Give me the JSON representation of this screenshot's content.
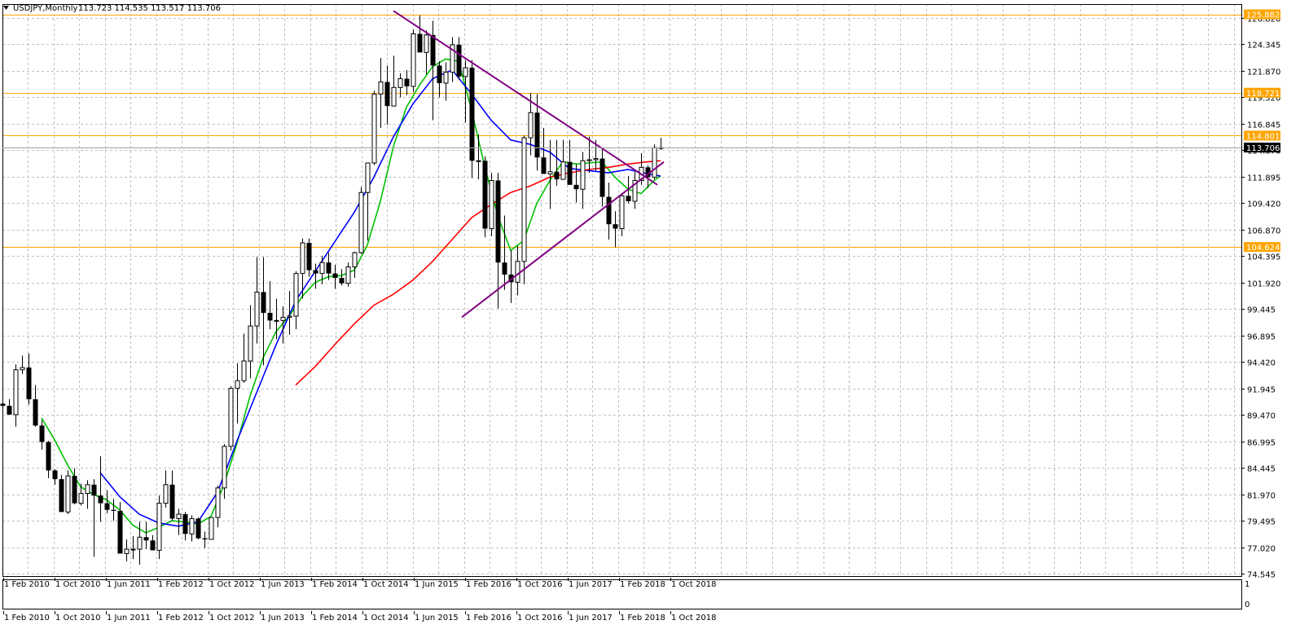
{
  "header": {
    "symbol_label": "USDJPY,Monthly",
    "ohlc": "113.723 114.535 113.517 113.706"
  },
  "colors": {
    "background": "#ffffff",
    "grid": "#c0c0c0",
    "candle": "#000000",
    "level": "#ffa500",
    "trendline": "#800080",
    "ma_fast": "#00c000",
    "ma_mid": "#0000ff",
    "ma_slow": "#ff0000",
    "price_tag": "#000000"
  },
  "chart_data": {
    "type": "candlestick",
    "symbol": "USDJPY",
    "timeframe": "Monthly",
    "x_ticks": [
      "1 Feb 2010",
      "1 Oct 2010",
      "1 Jun 2011",
      "1 Feb 2012",
      "1 Oct 2012",
      "1 Jun 2013",
      "1 Feb 2014",
      "1 Oct 2014",
      "1 Jun 2015",
      "1 Feb 2016",
      "1 Oct 2016",
      "1 Jun 2017",
      "1 Feb 2018",
      "1 Oct 2018"
    ],
    "y_ticks": [
      "126.820",
      "124.345",
      "121.870",
      "119.320",
      "116.845",
      "114.370",
      "111.895",
      "109.420",
      "106.870",
      "104.395",
      "101.920",
      "99.445",
      "96.895",
      "94.420",
      "91.945",
      "89.470",
      "86.995",
      "84.445",
      "81.970",
      "79.495",
      "77.020",
      "74.545"
    ],
    "ylim": [
      74.545,
      126.82
    ],
    "levels": [
      {
        "price": 125.882,
        "label": "125.882"
      },
      {
        "price": 118.721,
        "label": "118.721"
      },
      {
        "price": 114.801,
        "label": "114.801"
      },
      {
        "price": 104.624,
        "label": "104.624"
      }
    ],
    "current_price": {
      "price": 113.706,
      "label": "113.706"
    },
    "candles": [
      [
        90.3,
        90.6,
        89.6,
        90.1
      ],
      [
        90.1,
        90.7,
        89.3,
        89.3
      ],
      [
        89.3,
        93.9,
        88.2,
        93.4
      ],
      [
        93.4,
        94.7,
        93.0,
        93.6
      ],
      [
        93.6,
        94.9,
        90.2,
        90.7
      ],
      [
        90.7,
        92.0,
        88.2,
        88.3
      ],
      [
        88.3,
        88.8,
        86.1,
        86.8
      ],
      [
        86.8,
        86.9,
        83.5,
        84.2
      ],
      [
        84.2,
        84.3,
        82.9,
        83.4
      ],
      [
        83.4,
        83.8,
        80.8,
        80.4
      ],
      [
        80.4,
        84.2,
        80.2,
        83.7
      ],
      [
        83.7,
        84.4,
        81.1,
        81.2
      ],
      [
        81.2,
        83.0,
        81.0,
        82.1
      ],
      [
        82.1,
        83.3,
        80.7,
        82.9
      ],
      [
        82.9,
        83.4,
        76.3,
        81.9
      ],
      [
        81.9,
        85.5,
        79.5,
        81.2
      ],
      [
        81.2,
        82.4,
        80.3,
        80.6
      ],
      [
        80.6,
        81.6,
        79.6,
        80.5
      ],
      [
        80.5,
        81.3,
        76.8,
        76.6
      ],
      [
        76.6,
        77.9,
        75.9,
        77.0
      ],
      [
        77.0,
        78.2,
        76.1,
        77.0
      ],
      [
        77.0,
        79.5,
        75.6,
        78.1
      ],
      [
        78.1,
        79.5,
        77.0,
        77.8
      ],
      [
        77.8,
        78.3,
        76.9,
        76.9
      ],
      [
        76.9,
        81.9,
        76.1,
        81.2
      ],
      [
        81.2,
        84.2,
        80.8,
        82.9
      ],
      [
        82.9,
        84.2,
        79.6,
        79.8
      ],
      [
        79.8,
        80.7,
        78.3,
        80.2
      ],
      [
        80.2,
        80.4,
        77.8,
        78.4
      ],
      [
        78.4,
        80.1,
        77.7,
        79.8
      ],
      [
        79.8,
        79.9,
        77.9,
        78.0
      ],
      [
        78.0,
        78.6,
        77.1,
        77.9
      ],
      [
        77.9,
        79.9,
        77.9,
        79.9
      ],
      [
        79.9,
        82.8,
        79.0,
        82.6
      ],
      [
        82.6,
        86.6,
        81.6,
        86.4
      ],
      [
        86.4,
        91.9,
        86.0,
        91.7
      ],
      [
        91.7,
        94.0,
        88.5,
        92.4
      ],
      [
        92.4,
        96.7,
        92.2,
        94.2
      ],
      [
        94.2,
        99.3,
        92.6,
        97.4
      ],
      [
        97.4,
        103.7,
        95.8,
        100.5
      ],
      [
        100.5,
        103.7,
        93.8,
        98.6
      ],
      [
        98.6,
        101.5,
        97.1,
        97.9
      ],
      [
        97.9,
        99.9,
        96.2,
        97.9
      ],
      [
        97.9,
        99.2,
        95.8,
        98.2
      ],
      [
        98.2,
        100.6,
        96.6,
        98.3
      ],
      [
        98.3,
        102.4,
        97.1,
        102.2
      ],
      [
        102.2,
        105.4,
        99.9,
        105.0
      ],
      [
        105.0,
        105.4,
        101.9,
        102.5
      ],
      [
        102.5,
        103.1,
        100.8,
        102.2
      ],
      [
        102.2,
        103.8,
        101.2,
        103.2
      ],
      [
        103.2,
        104.1,
        101.6,
        102.2
      ],
      [
        102.2,
        103.0,
        100.8,
        101.8
      ],
      [
        101.8,
        102.6,
        101.1,
        101.3
      ],
      [
        101.3,
        103.2,
        101.0,
        102.8
      ],
      [
        102.8,
        104.2,
        101.8,
        104.1
      ],
      [
        104.1,
        110.1,
        104.0,
        109.6
      ],
      [
        109.6,
        111.9,
        105.2,
        112.3
      ],
      [
        112.3,
        118.9,
        112.1,
        118.6
      ],
      [
        118.6,
        121.9,
        115.5,
        119.7
      ],
      [
        119.7,
        121.2,
        115.8,
        117.5
      ],
      [
        117.5,
        122.1,
        118.0,
        119.2
      ],
      [
        119.2,
        120.5,
        118.3,
        120.0
      ],
      [
        120.0,
        120.8,
        118.5,
        119.3
      ],
      [
        119.3,
        124.5,
        118.8,
        124.1
      ],
      [
        124.1,
        125.8,
        122.5,
        122.4
      ],
      [
        122.4,
        124.4,
        120.4,
        124.0
      ],
      [
        124.0,
        125.3,
        116.2,
        121.2
      ],
      [
        121.2,
        121.6,
        118.3,
        119.6
      ],
      [
        119.6,
        121.5,
        118.0,
        120.6
      ],
      [
        120.6,
        123.8,
        119.7,
        123.1
      ],
      [
        123.1,
        123.8,
        119.9,
        120.2
      ],
      [
        120.2,
        121.7,
        116.0,
        121.0
      ],
      [
        121.0,
        121.7,
        110.9,
        112.5
      ],
      [
        112.5,
        114.9,
        110.8,
        112.5
      ],
      [
        112.5,
        112.9,
        105.5,
        106.3
      ],
      [
        106.3,
        111.4,
        105.6,
        110.7
      ],
      [
        110.7,
        111.4,
        99.0,
        103.2
      ],
      [
        103.2,
        107.5,
        100.7,
        102.1
      ],
      [
        102.1,
        104.3,
        99.5,
        101.4
      ],
      [
        101.4,
        104.7,
        100.2,
        103.3
      ],
      [
        103.3,
        114.8,
        101.2,
        114.6
      ],
      [
        114.6,
        118.7,
        113.0,
        116.9
      ],
      [
        116.9,
        118.6,
        111.6,
        112.8
      ],
      [
        112.8,
        115.5,
        111.7,
        111.3
      ],
      [
        111.3,
        114.4,
        108.1,
        111.5
      ],
      [
        111.5,
        114.4,
        110.2,
        110.8
      ],
      [
        110.8,
        114.4,
        110.8,
        112.4
      ],
      [
        112.4,
        114.4,
        111.0,
        110.3
      ],
      [
        110.3,
        112.2,
        108.7,
        109.9
      ],
      [
        109.9,
        113.3,
        108.1,
        112.5
      ],
      [
        112.5,
        114.7,
        111.4,
        112.6
      ],
      [
        112.6,
        114.4,
        111.6,
        112.7
      ],
      [
        112.7,
        113.7,
        108.3,
        109.2
      ],
      [
        109.2,
        110.5,
        105.3,
        106.7
      ],
      [
        106.7,
        107.9,
        104.6,
        106.3
      ],
      [
        106.3,
        109.5,
        105.6,
        109.3
      ],
      [
        109.3,
        111.1,
        108.6,
        108.8
      ],
      [
        108.8,
        111.5,
        108.1,
        110.7
      ],
      [
        110.7,
        113.2,
        110.3,
        111.9
      ],
      [
        111.9,
        112.1,
        110.0,
        111.0
      ],
      [
        111.0,
        114.0,
        110.8,
        113.7
      ],
      [
        113.7,
        114.6,
        113.5,
        113.7
      ]
    ],
    "series": [
      {
        "values": [
          [
            6,
            89.0
          ],
          [
            8,
            87.0
          ],
          [
            10,
            84.7
          ],
          [
            12,
            82.7
          ],
          [
            14,
            82.0
          ],
          [
            16,
            81.5
          ],
          [
            18,
            80.6
          ],
          [
            20,
            79.2
          ],
          [
            22,
            78.5
          ],
          [
            24,
            79.0
          ],
          [
            26,
            79.6
          ],
          [
            28,
            79.5
          ],
          [
            30,
            79.3
          ],
          [
            32,
            80.0
          ],
          [
            34,
            82.9
          ],
          [
            36,
            86.7
          ],
          [
            38,
            91.0
          ],
          [
            40,
            94.5
          ],
          [
            42,
            96.9
          ],
          [
            44,
            98.3
          ],
          [
            46,
            100.1
          ],
          [
            48,
            101.4
          ],
          [
            50,
            101.9
          ],
          [
            52,
            102.0
          ],
          [
            54,
            102.5
          ],
          [
            56,
            104.8
          ],
          [
            58,
            108.8
          ],
          [
            60,
            113.8
          ],
          [
            62,
            117.4
          ],
          [
            64,
            119.4
          ],
          [
            66,
            121.1
          ],
          [
            68,
            121.8
          ],
          [
            70,
            121.6
          ],
          [
            72,
            117.1
          ],
          [
            74,
            112.0
          ],
          [
            76,
            107.5
          ],
          [
            78,
            104.3
          ],
          [
            80,
            105.2
          ],
          [
            82,
            108.6
          ],
          [
            84,
            110.7
          ],
          [
            86,
            112.4
          ],
          [
            88,
            112.2
          ],
          [
            90,
            112.3
          ],
          [
            92,
            112.4
          ],
          [
            94,
            111.0
          ],
          [
            96,
            109.9
          ],
          [
            98,
            109.5
          ],
          [
            100,
            110.7
          ],
          [
            101,
            111.1
          ]
        ]
      },
      {
        "values": [
          [
            15,
            84.0
          ],
          [
            18,
            81.8
          ],
          [
            21,
            80.2
          ],
          [
            24,
            79.4
          ],
          [
            27,
            79.1
          ],
          [
            30,
            79.5
          ],
          [
            33,
            82.2
          ],
          [
            36,
            86.9
          ],
          [
            39,
            91.3
          ],
          [
            42,
            95.7
          ],
          [
            45,
            99.7
          ],
          [
            48,
            102.4
          ],
          [
            51,
            105.1
          ],
          [
            54,
            107.8
          ],
          [
            57,
            111.0
          ],
          [
            60,
            114.7
          ],
          [
            63,
            117.7
          ],
          [
            66,
            120.0
          ],
          [
            69,
            120.8
          ],
          [
            72,
            118.6
          ],
          [
            75,
            116.2
          ],
          [
            78,
            114.4
          ],
          [
            81,
            114.0
          ],
          [
            84,
            113.3
          ],
          [
            87,
            111.8
          ],
          [
            90,
            111.6
          ],
          [
            93,
            111.4
          ],
          [
            96,
            111.7
          ],
          [
            99,
            111.3
          ],
          [
            101,
            111.1
          ]
        ]
      },
      {
        "values": [
          [
            45,
            92.0
          ],
          [
            48,
            93.7
          ],
          [
            51,
            95.7
          ],
          [
            54,
            97.6
          ],
          [
            57,
            99.3
          ],
          [
            60,
            100.3
          ],
          [
            63,
            101.6
          ],
          [
            66,
            103.3
          ],
          [
            69,
            105.3
          ],
          [
            72,
            107.3
          ],
          [
            75,
            108.5
          ],
          [
            78,
            109.6
          ],
          [
            81,
            110.2
          ],
          [
            84,
            111.0
          ],
          [
            87,
            111.4
          ],
          [
            90,
            111.7
          ],
          [
            93,
            111.9
          ],
          [
            96,
            112.2
          ],
          [
            99,
            112.4
          ],
          [
            101,
            112.5
          ]
        ]
      }
    ],
    "trendlines": [
      {
        "from": [
          60,
          126.2
        ],
        "to": [
          100.5,
          110.3
        ]
      },
      {
        "from": [
          70.5,
          98.2
        ],
        "to": [
          101.5,
          112.4
        ]
      }
    ]
  }
}
